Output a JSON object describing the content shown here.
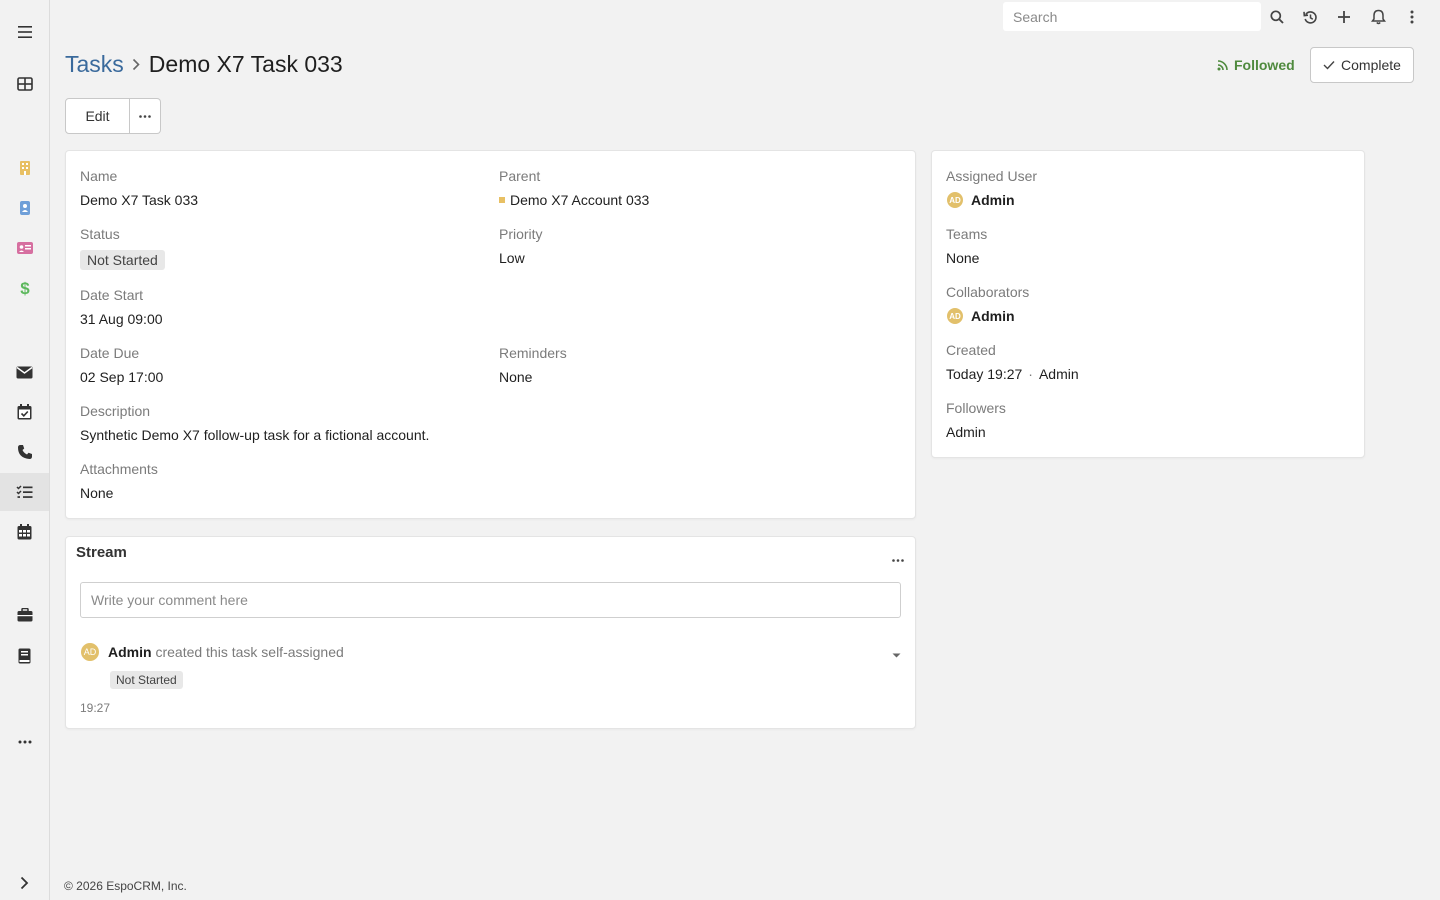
{
  "topbar": {
    "search_placeholder": "Search"
  },
  "sidebar": {
    "items": [
      {
        "name": "menu-icon"
      },
      {
        "name": "dashboard-icon"
      },
      {
        "name": "accounts-icon",
        "color": "#e8c064"
      },
      {
        "name": "contacts-icon",
        "color": "#6f9fd8"
      },
      {
        "name": "leads-icon",
        "color": "#d66fa0"
      },
      {
        "name": "opportunities-icon",
        "color": "#5cb85c"
      },
      {
        "name": "emails-icon"
      },
      {
        "name": "meetings-icon"
      },
      {
        "name": "calls-icon"
      },
      {
        "name": "tasks-icon",
        "active": true
      },
      {
        "name": "calendar-icon"
      },
      {
        "name": "cases-icon"
      },
      {
        "name": "knowledge-base-icon"
      },
      {
        "name": "more-icon"
      },
      {
        "name": "expand-icon"
      }
    ]
  },
  "header": {
    "breadcrumb_link": "Tasks",
    "title": "Demo X7 Task 033",
    "followed_label": "Followed",
    "complete_label": "Complete",
    "edit_label": "Edit"
  },
  "detail": {
    "name_label": "Name",
    "name_value": "Demo X7 Task 033",
    "parent_label": "Parent",
    "parent_value": "Demo X7 Account 033",
    "status_label": "Status",
    "status_value": "Not Started",
    "priority_label": "Priority",
    "priority_value": "Low",
    "date_start_label": "Date Start",
    "date_start_value": "31 Aug 09:00",
    "date_due_label": "Date Due",
    "date_due_value": "02 Sep 17:00",
    "reminders_label": "Reminders",
    "reminders_value": "None",
    "description_label": "Description",
    "description_value": "Synthetic Demo X7 follow-up task for a fictional account.",
    "attachments_label": "Attachments",
    "attachments_value": "None"
  },
  "side": {
    "assigned_user_label": "Assigned User",
    "assigned_user_value": "Admin",
    "teams_label": "Teams",
    "teams_value": "None",
    "collaborators_label": "Collaborators",
    "collaborators_value": "Admin",
    "created_label": "Created",
    "created_time": "Today 19:27",
    "created_sep": "·",
    "created_by": "Admin",
    "followers_label": "Followers",
    "followers_value": "Admin",
    "avatar_initials": "AD"
  },
  "stream": {
    "title": "Stream",
    "comment_placeholder": "Write your comment here",
    "note_author": "Admin",
    "note_action": "created this task self-assigned",
    "note_status": "Not Started",
    "note_time": "19:27"
  },
  "footer": {
    "text": "© 2026 EspoCRM, Inc."
  }
}
